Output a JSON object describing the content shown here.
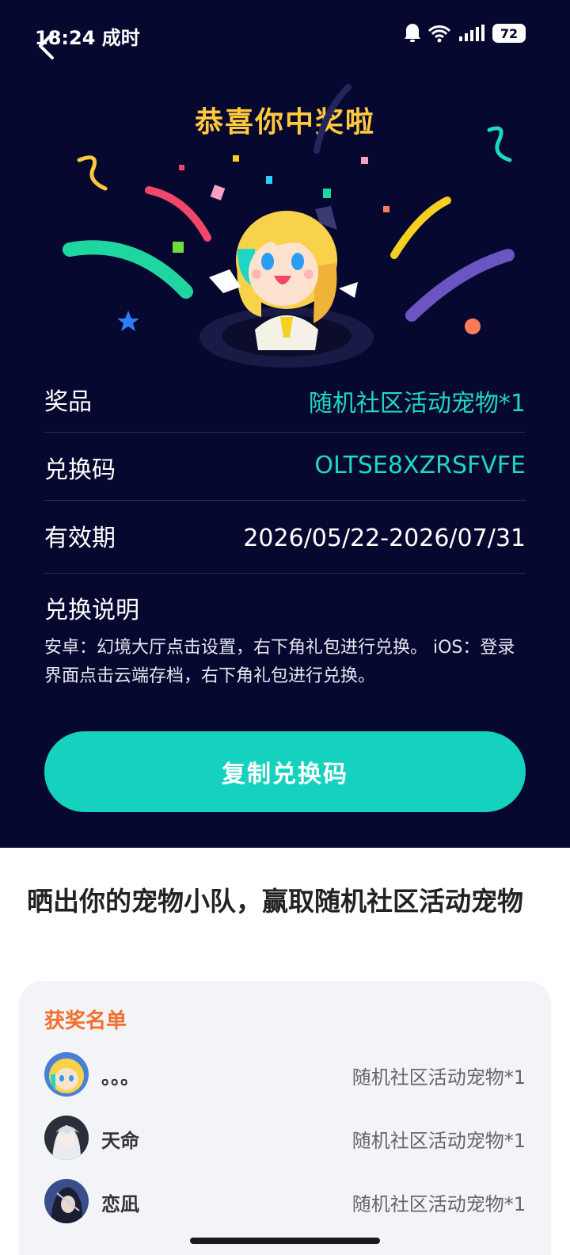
{
  "status_bar": {
    "time": "18:24 成时",
    "battery": "72"
  },
  "header": {
    "title": "恭喜你中奖啦"
  },
  "prize": {
    "label": "奖品",
    "value": "随机社区活动宠物*1"
  },
  "code": {
    "label": "兑换码",
    "value": "OLTSE8XZRSFVFE"
  },
  "validity": {
    "label": "有效期",
    "value": "2026/05/22-2026/07/31"
  },
  "instructions": {
    "title": "兑换说明",
    "text": "安卓：幻境大厅点击设置，右下角礼包进行兑换。 iOS：登录界面点击云端存档，右下角礼包进行兑换。"
  },
  "copy_button_label": "复制兑换码",
  "section": {
    "title": "晒出你的宠物小队，赢取随机社区活动宠物"
  },
  "winners": {
    "heading": "获奖名单",
    "list": [
      {
        "name": "。。。",
        "prize": "随机社区活动宠物*1"
      },
      {
        "name": "天命",
        "prize": "随机社区活动宠物*1"
      },
      {
        "name": "恋凪",
        "prize": "随机社区活动宠物*1"
      }
    ]
  },
  "colors": {
    "background": "#070830",
    "accent": "#15d2bf",
    "title_gold": "#ffc93c",
    "winner_heading": "#f26f2c"
  }
}
